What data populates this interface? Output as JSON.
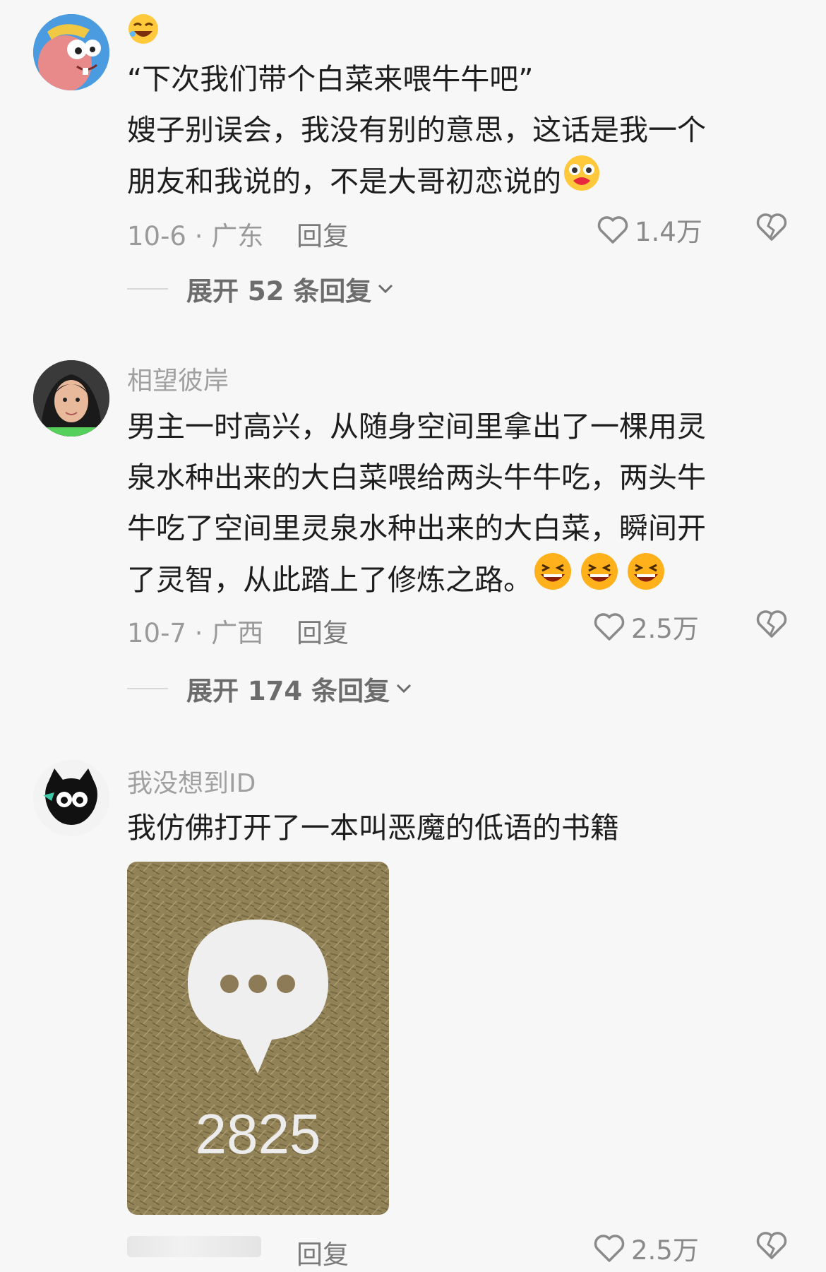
{
  "colors": {
    "background": "#f7f7f7",
    "text": "#1e1e1e",
    "muted": "#9a9a9a"
  },
  "comments": [
    {
      "lines": [
        "“下次我们带个白菜来喂牛牛吧”",
        "嫂子别误会，我没有别的意思，这话是我一个",
        "朋友和我说的，不是大哥初恋说的"
      ],
      "date": "10-6 · 广东",
      "reply": "回复",
      "likes": "1.4万",
      "expand": "展开 52 条回复",
      "avatar_icon": "cartoon-avatar-icon"
    },
    {
      "username": "相望彼岸",
      "lines": [
        "男主一时高兴，从随身空间里拿出了一棵用灵",
        "泉水种出来的大白菜喂给两头牛牛吃，两头牛",
        "牛吃了空间里灵泉水种出来的大白菜，瞬间开",
        "了灵智，从此踏上了修炼之路。"
      ],
      "date": "10-7 · 广西",
      "reply": "回复",
      "likes": "2.5万",
      "expand": "展开 174 条回复",
      "avatar_icon": "photo-avatar-icon"
    },
    {
      "username": "我没想到ID",
      "lines": [
        "我仿佛打开了一本叫恶魔的低语的书籍"
      ],
      "image_count": "2825",
      "reply": "回复",
      "likes": "2.5万",
      "avatar_icon": "cat-avatar-icon"
    }
  ]
}
